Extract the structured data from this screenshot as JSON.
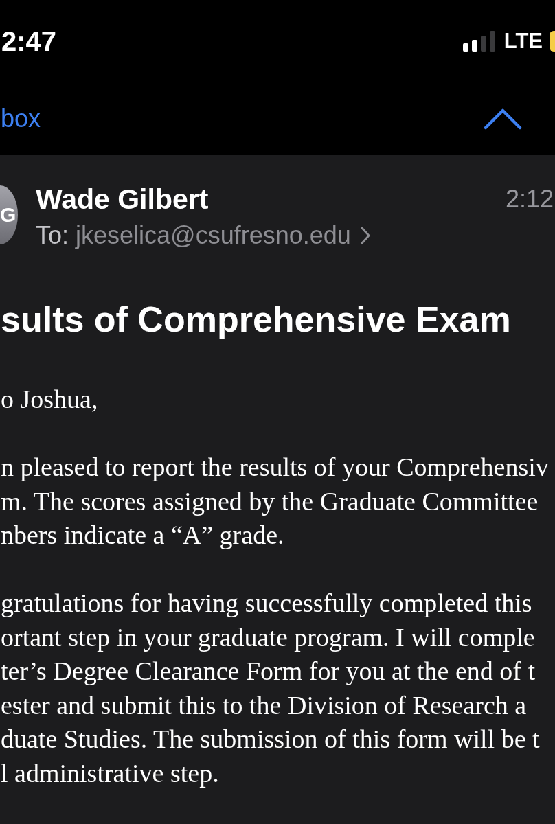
{
  "status_bar": {
    "time": "2:47",
    "network": "LTE"
  },
  "nav_bar": {
    "back_label": "box"
  },
  "message": {
    "avatar_initial": "G",
    "sender": "Wade Gilbert",
    "to_label": "To:",
    "recipient": "jkeselica@csufresno.edu",
    "time": "2:12"
  },
  "subject": "sults of Comprehensive Exam",
  "body": [
    {
      "lines": [
        "o Joshua,"
      ]
    },
    {
      "lines": [
        "n pleased to report the results of your Comprehensiv",
        "m. The scores assigned by the Graduate Committee",
        "nbers indicate a “A” grade."
      ]
    },
    {
      "lines": [
        "gratulations for having successfully completed this",
        "ortant step in your graduate program. I will comple",
        "ter’s Degree Clearance Form for you at the end of t",
        "ester and submit this to the Division of Research a",
        "duate Studies. The submission of this form will be t",
        "l administrative step."
      ]
    }
  ]
}
